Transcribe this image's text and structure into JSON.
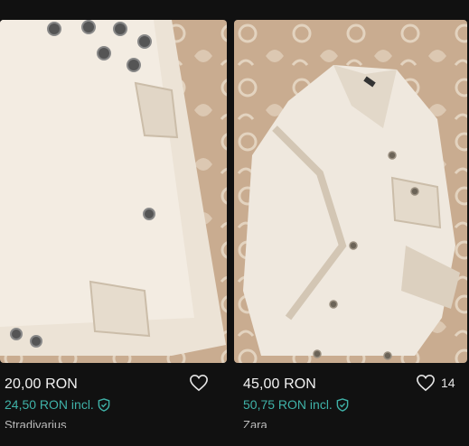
{
  "listings": [
    {
      "price": "20,00 RON",
      "price_incl": "24,50 RON incl.",
      "brand": "Stradivarius",
      "favourites": "",
      "image_icon": "white-denim-shorts-photo"
    },
    {
      "price": "45,00 RON",
      "price_incl": "50,75 RON incl.",
      "brand": "Zara",
      "favourites": "14",
      "image_icon": "white-denim-jacket-photo"
    }
  ],
  "colors": {
    "background": "#111111",
    "price_incl": "#3fb2a8",
    "text": "#f2f2f2"
  }
}
